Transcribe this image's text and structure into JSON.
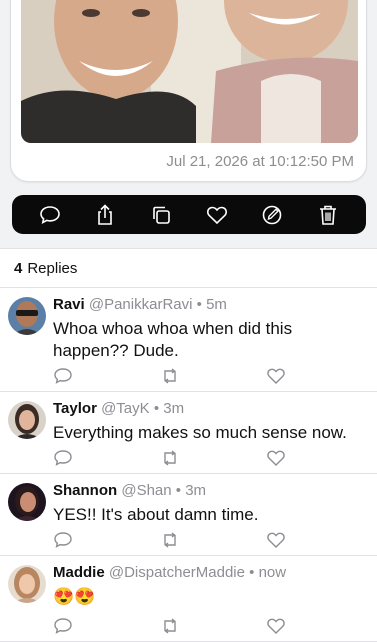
{
  "post": {
    "timestamp": "Jul 21, 2026 at 10:12:50 PM"
  },
  "action_bar": {
    "icons": [
      "comment-icon",
      "share-icon",
      "copy-icon",
      "heart-icon",
      "edit-icon",
      "trash-icon"
    ]
  },
  "replies_header": {
    "count": "4",
    "label": "Replies"
  },
  "replies": [
    {
      "name": "Ravi",
      "handle": "@PanikkarRavi",
      "separator": "•",
      "time": "5m",
      "text": "Whoa whoa whoa when did this happen?? Dude."
    },
    {
      "name": "Taylor",
      "handle": "@TayK",
      "separator": "•",
      "time": "3m",
      "text": "Everything makes so much sense now."
    },
    {
      "name": "Shannon",
      "handle": "@Shan",
      "separator": "•",
      "time": "3m",
      "text": "YES!! It's about damn time."
    },
    {
      "name": "Maddie",
      "handle": "@DispatcherMaddie",
      "separator": "•",
      "time": "now",
      "text": "😍😍"
    }
  ],
  "colors": {
    "background": "#f1f2f4",
    "action_bar": "#0a0a0a",
    "secondary_text": "#8d8d93",
    "divider": "#e2e2e6"
  }
}
